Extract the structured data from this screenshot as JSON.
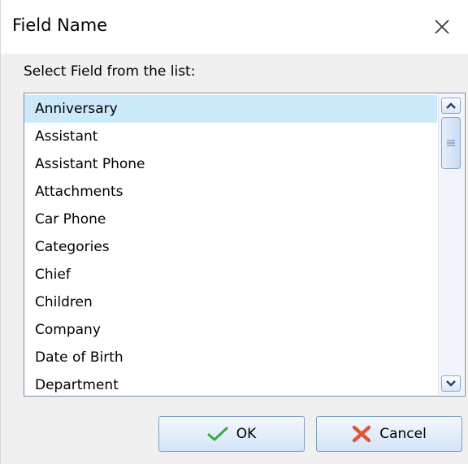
{
  "dialog": {
    "title": "Field Name",
    "prompt": "Select Field from the list:"
  },
  "list": {
    "selected_index": 0,
    "items": [
      "Anniversary",
      "Assistant",
      "Assistant Phone",
      "Attachments",
      "Car Phone",
      "Categories",
      "Chief",
      "Children",
      "Company",
      "Date of Birth",
      "Department"
    ]
  },
  "buttons": {
    "ok_label": "OK",
    "cancel_label": "Cancel"
  },
  "icons": {
    "close": "close-icon",
    "ok": "checkmark-icon",
    "cancel": "cross-icon",
    "scroll_up": "chevron-up-icon",
    "scroll_down": "chevron-down-icon"
  },
  "colors": {
    "selection": "#cce8fb",
    "ok_check": "#3aa84a",
    "cancel_cross": "#e2543a"
  }
}
